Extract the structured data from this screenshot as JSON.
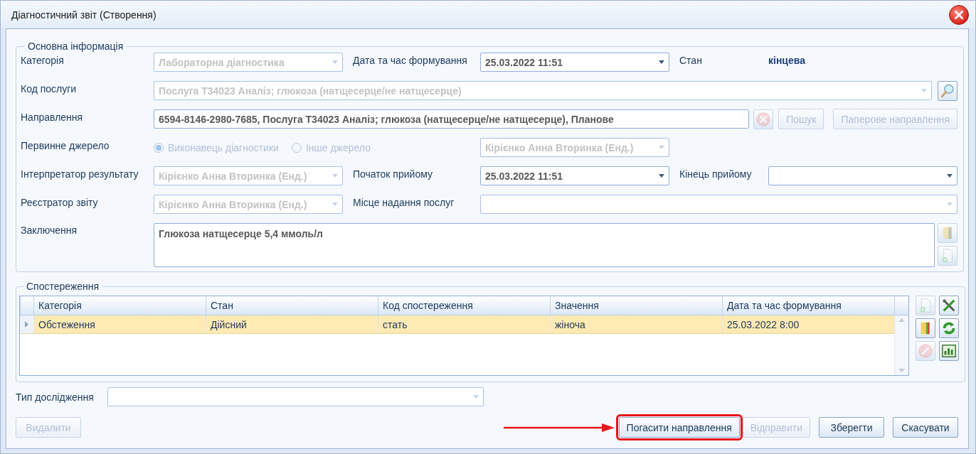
{
  "window": {
    "title": "Діагностичний звіт (Створення)"
  },
  "main_info": {
    "legend": "Основна інформація",
    "category": {
      "label": "Категорія",
      "value": "Лабораторна діагностика",
      "disabled": true
    },
    "formed_at": {
      "label": "Дата та час формування",
      "value": "25.03.2022 11:51",
      "disabled": false
    },
    "status": {
      "label": "Стан",
      "value": "кінцева"
    },
    "service_code": {
      "label": "Код послуги",
      "value": "Послуга Т34023 Аналіз; глюкоза (натщесерце/не натщесерце)",
      "disabled": true
    },
    "service_tool": {
      "kind": "search",
      "disabled": false
    },
    "referral": {
      "label": "Направлення",
      "value": "6594-8146-2980-7685, Послуга Т34023 Аналіз; глюкоза (натщесерце/не натщесерце), Планове"
    },
    "referral_tool": {
      "kind": "clear",
      "disabled": true
    },
    "referral_buttons": [
      {
        "label": "Пошук",
        "disabled": true
      },
      {
        "label": "Паперове направлення",
        "disabled": true
      }
    ],
    "primary_source": {
      "label": "Первинне джерело",
      "disabled": true,
      "options": [
        {
          "label": "Виконавець діагностики",
          "selected": true
        },
        {
          "label": "Інше джерело",
          "selected": false
        }
      ],
      "value": "Кірієнко Анна Вторинка (Енд.)"
    },
    "interpreter": {
      "label": "Інтерпретатор результату",
      "value": "Кірієнко Анна Вторинка (Енд.)",
      "disabled": true
    },
    "start": {
      "label": "Початок прийому",
      "value": "25.03.2022 11:51",
      "disabled": false
    },
    "end": {
      "label": "Кінець прийому",
      "disabled": false
    },
    "registrar": {
      "label": "Реєстратор звіту",
      "value": "Кірієнко Анна Вторинка (Енд.)",
      "disabled": true
    },
    "place": {
      "label": "Місце надання послуг",
      "disabled": true
    },
    "conclusion": {
      "label": "Заключення",
      "value": "Глюкоза натщесерце 5,4 ммоль/л"
    },
    "conclusion_tools": [
      {
        "kind": "folder",
        "disabled": true
      },
      {
        "kind": "new-document",
        "disabled": true
      }
    ]
  },
  "observations": {
    "legend": "Спостереження",
    "columns": [
      "Категорія",
      "Стан",
      "Код спостереження",
      "Значення",
      "Дата та час формування"
    ],
    "rows": [
      {
        "cells": [
          "Обстеження",
          "Дійсний",
          "стать",
          "жіноча",
          "25.03.2022 8:00"
        ],
        "selected": true
      }
    ],
    "tools": [
      {
        "kind": "new-document",
        "disabled": true
      },
      {
        "kind": "tools",
        "disabled": false
      },
      {
        "kind": "folder",
        "disabled": false
      },
      {
        "kind": "refresh",
        "disabled": false
      },
      {
        "kind": "cancel",
        "disabled": true
      },
      {
        "kind": "table",
        "disabled": false
      }
    ]
  },
  "study_type": {
    "label": "Тип дослідження",
    "disabled": true
  },
  "buttons": [
    {
      "label": "Видалити",
      "disabled": true,
      "highlighted": false
    },
    {
      "label": "Погасити направлення",
      "disabled": false,
      "highlighted": true
    },
    {
      "label": "Відправити",
      "disabled": true,
      "highlighted": false
    },
    {
      "label": "Зберегти",
      "disabled": false,
      "highlighted": false
    },
    {
      "label": "Скасувати",
      "disabled": false,
      "highlighted": false
    }
  ]
}
